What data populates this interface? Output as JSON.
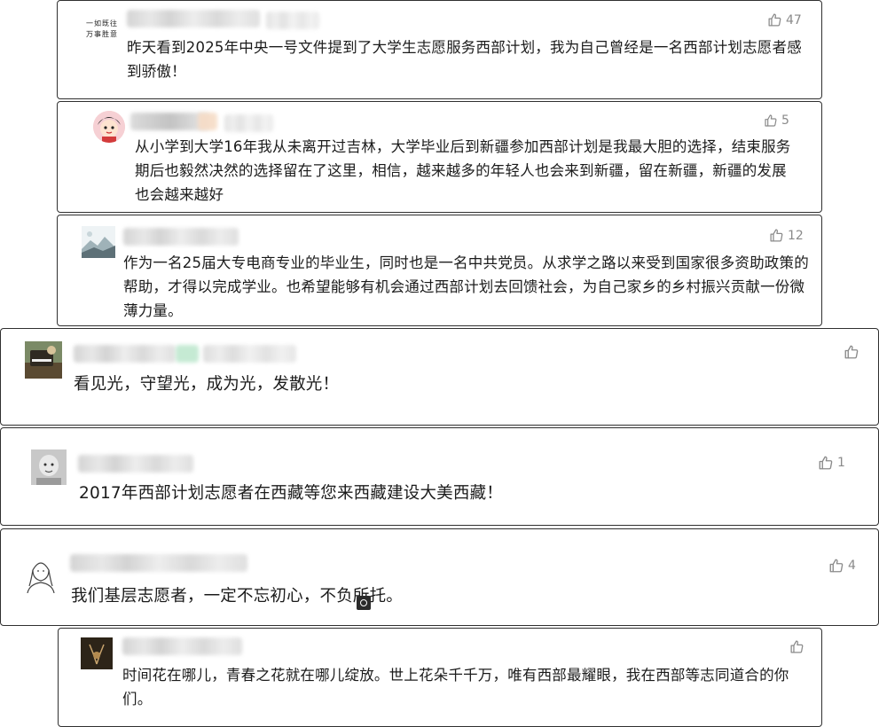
{
  "colors": {
    "border": "#303030",
    "text": "#1b1b1b",
    "like": "#8a8a8a"
  },
  "comments": [
    {
      "avatar_icon": "calligraphy-avatar-icon",
      "avatar_text": "一如既往 万事胜意",
      "like_count": "47",
      "text": "昨天看到2025年中央一号文件提到了大学生志愿服务西部计划，我为自己曾经是一名西部计划志愿者感到骄傲！"
    },
    {
      "avatar_icon": "cartoon-girl-avatar-icon",
      "like_count": "5",
      "text": "从小学到大学16年我从未离开过吉林，大学毕业后到新疆参加西部计划是我最大胆的选择，结束服务期后也毅然决然的选择留在了这里，相信，越来越多的年轻人也会来到新疆，留在新疆，新疆的发展也会越来越好"
    },
    {
      "avatar_icon": "landscape-avatar-icon",
      "like_count": "12",
      "text": "作为一名25届大专电商专业的毕业生，同时也是一名中共党员。从求学之路以来受到国家很多资助政策的帮助，才得以完成学业。也希望能够有机会通过西部计划去回馈社会，为自己家乡的乡村振兴贡献一份微薄力量。"
    },
    {
      "avatar_icon": "piano-photo-avatar-icon",
      "like_count": "",
      "text": "看见光，守望光，成为光，发散光！"
    },
    {
      "avatar_icon": "baby-photo-avatar-icon",
      "like_count": "1",
      "text": "2017年西部计划志愿者在西藏等您来西藏建设大美西藏！"
    },
    {
      "avatar_icon": "sketch-portrait-avatar-icon",
      "like_count": "4",
      "text": "我们基层志愿者，一定不忘初心，不负所托。"
    },
    {
      "avatar_icon": "deer-photo-avatar-icon",
      "like_count": "",
      "text": "时间花在哪儿，青春之花就在哪儿绽放。世上花朵千千万，唯有西部最耀眼，我在西部等志同道合的你们。"
    }
  ]
}
